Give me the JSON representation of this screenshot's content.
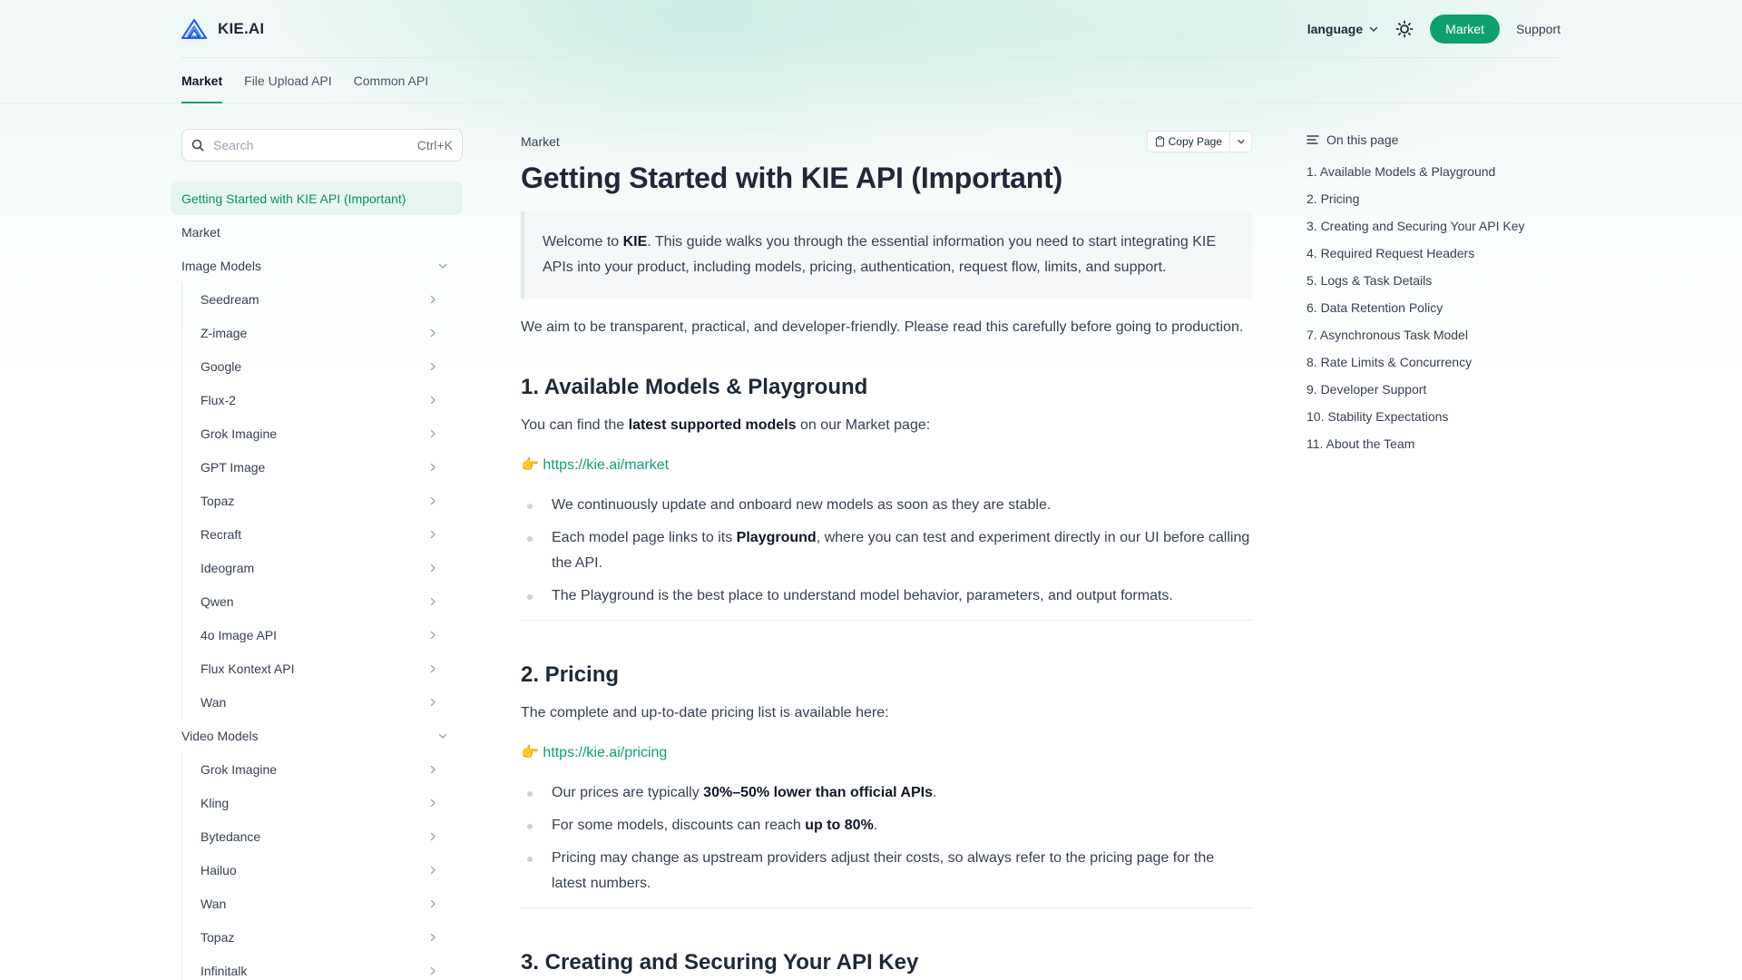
{
  "brand": {
    "name": "KIE.AI"
  },
  "topbar": {
    "language_label": "language",
    "market_label": "Market",
    "support_label": "Support"
  },
  "tabs": [
    {
      "label": "Market",
      "active": true
    },
    {
      "label": "File Upload API",
      "active": false
    },
    {
      "label": "Common API",
      "active": false
    }
  ],
  "sidebar": {
    "search_placeholder": "Search",
    "search_shortcut": "Ctrl+K",
    "active_item": "Getting Started with KIE API (Important)",
    "market_item": "Market",
    "image_group": "Image Models",
    "image_items": [
      "Seedream",
      "Z-image",
      "Google",
      "Flux-2",
      "Grok Imagine",
      "GPT Image",
      "Topaz",
      "Recraft",
      "Ideogram",
      "Qwen",
      "4o Image API",
      "Flux Kontext API",
      "Wan"
    ],
    "video_group": "Video Models",
    "video_items": [
      "Grok Imagine",
      "Kling",
      "Bytedance",
      "Hailuo",
      "Wan",
      "Topaz",
      "Infinitalk"
    ]
  },
  "main": {
    "breadcrumb": "Market",
    "copy_label": "Copy Page",
    "title": "Getting Started with KIE API (Important)",
    "callout_pre": "Welcome to ",
    "callout_bold": "KIE",
    "callout_post": ". This guide walks you through the essential information you need to start integrating KIE APIs into your product, including models, pricing, authentication, request flow, limits, and support.",
    "intro": "We aim to be transparent, practical, and developer-friendly. Please read this carefully before going to production.",
    "s1": {
      "heading": "1. Available Models & Playground",
      "lead_pre": "You can find the ",
      "lead_bold": "latest supported models",
      "lead_post": " on our Market page:",
      "emoji": "👉",
      "link": "https://kie.ai/market",
      "b1": "We continuously update and onboard new models as soon as they are stable.",
      "b2_pre": "Each model page links to its ",
      "b2_bold": "Playground",
      "b2_post": ", where you can test and experiment directly in our UI before calling the API.",
      "b3": "The Playground is the best place to understand model behavior, parameters, and output formats."
    },
    "s2": {
      "heading": "2. Pricing",
      "lead": "The complete and up-to-date pricing list is available here:",
      "emoji": "👉",
      "link": "https://kie.ai/pricing",
      "b1_pre": "Our prices are typically ",
      "b1_bold": "30%–50% lower than official APIs",
      "b1_post": ".",
      "b2_pre": "For some models, discounts can reach ",
      "b2_bold": "up to 80%",
      "b2_post": ".",
      "b3": "Pricing may change as upstream providers adjust their costs, so always refer to the pricing page for the latest numbers."
    },
    "s3": {
      "heading": "3. Creating and Securing Your API Key"
    }
  },
  "toc": {
    "title": "On this page",
    "items": [
      "1. Available Models & Playground",
      "2. Pricing",
      "3. Creating and Securing Your API Key",
      "4. Required Request Headers",
      "5. Logs & Task Details",
      "6. Data Retention Policy",
      "7. Asynchronous Task Model",
      "8. Rate Limits & Concurrency",
      "9. Developer Support",
      "10. Stability Expectations",
      "11. About the Team"
    ]
  },
  "colors": {
    "accent": "#10a06e",
    "text": "#1f2937"
  }
}
